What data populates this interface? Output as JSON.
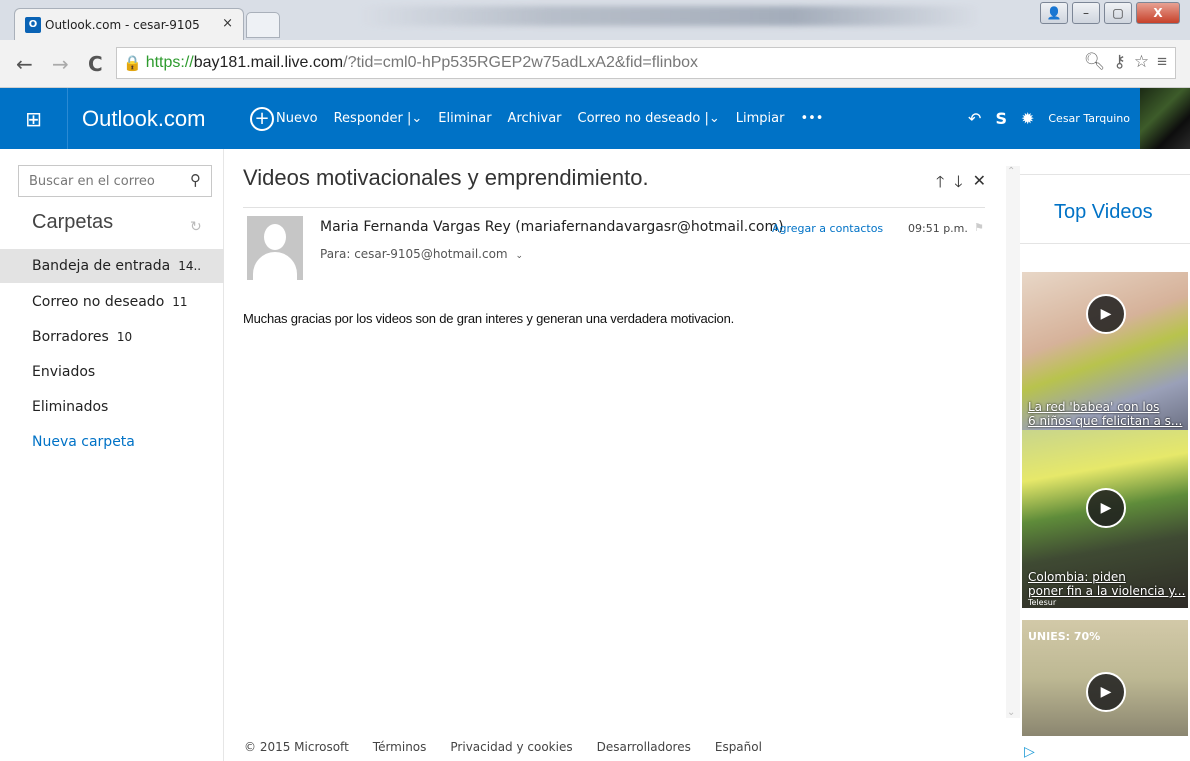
{
  "browser": {
    "tab_title": "Outlook.com - cesar-9105",
    "tab_close": "×",
    "tab_favicon": "O",
    "url_scheme": "https://",
    "url_host": "bay181.mail.live.com",
    "url_path": "/?tid=cml0-hPp535RGEP2w75adLxA2&fid=flinbox",
    "back": "←",
    "forward": "→",
    "reload": "C",
    "lock": "🔒",
    "window_minimize": "–",
    "window_maximize": "▢",
    "window_close": "X",
    "window_user": "👤"
  },
  "header": {
    "brand": "Outlook.com",
    "waffle": "⊞",
    "commands": {
      "new": "Nuevo",
      "reply": "Responder",
      "delete": "Eliminar",
      "archive": "Archivar",
      "junk": "Correo no deseado",
      "clean": "Limpiar",
      "more": "•••"
    },
    "user_name": "Cesar Tarquino",
    "undo_icon": "↶",
    "skype_icon": "S",
    "settings_icon": "✹"
  },
  "sidebar": {
    "search_placeholder": "Buscar en el correo",
    "folders_heading": "Carpetas",
    "folders": [
      {
        "label": "Bandeja de entrada",
        "count": "14.."
      },
      {
        "label": "Correo no deseado",
        "count": "11"
      },
      {
        "label": "Borradores",
        "count": "10"
      },
      {
        "label": "Enviados",
        "count": ""
      },
      {
        "label": "Eliminados",
        "count": ""
      }
    ],
    "new_folder": "Nueva carpeta"
  },
  "message": {
    "subject": "Videos motivacionales y emprendimiento.",
    "sender": "Maria Fernanda Vargas Rey (mariafernandavargasr@hotmail.com)",
    "add_contact": "Agregar a contactos",
    "time": "09:51 p.m.",
    "recipient": "Para: cesar-9105@hotmail.com",
    "body": "Muchas gracias por los videos son de gran interes y generan una verdadera motivacion."
  },
  "ads": {
    "title": "Top Videos",
    "videos": [
      {
        "caption_line1": "La red 'babea' con los",
        "caption_line2": "6 niños que felicitan a s..."
      },
      {
        "caption_line1": "Colombia: piden",
        "caption_line2": "poner fin a la violencia y...",
        "source": "Telesur"
      },
      {
        "tag": "UNIES: 70%"
      }
    ]
  },
  "footer": {
    "copyright": "© 2015 Microsoft",
    "terms": "Términos",
    "privacy": "Privacidad y cookies",
    "developers": "Desarrolladores",
    "language": "Español"
  }
}
